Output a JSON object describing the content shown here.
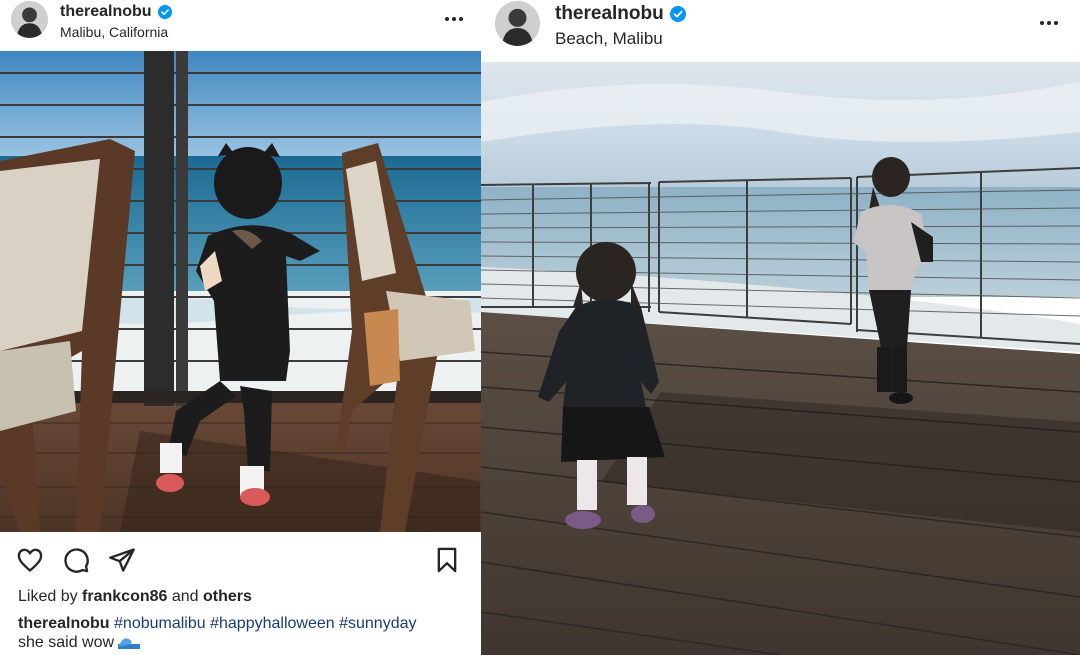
{
  "colors": {
    "text": "#262626",
    "verified": "#0095f6",
    "hashtag": "#1a3d7a"
  },
  "posts": [
    {
      "username": "therealnobu",
      "location": "Malibu, California",
      "icons": [
        "verified-badge-icon",
        "more-options-icon",
        "heart-icon",
        "comment-icon",
        "share-icon",
        "bookmark-icon"
      ],
      "likes": {
        "prefix": "Liked by",
        "user": "frankcon86",
        "conjunction": "and",
        "others": "others"
      },
      "caption": {
        "user": "therealnobu",
        "hashtags": [
          "#nobumalibu",
          "#happyhalloween",
          "#sunnyday"
        ],
        "text": "she said wow",
        "emoji": "wave-emoji"
      }
    },
    {
      "username": "therealnobu",
      "location": "Beach, Malibu",
      "icons": [
        "verified-badge-icon",
        "more-options-icon"
      ]
    }
  ]
}
